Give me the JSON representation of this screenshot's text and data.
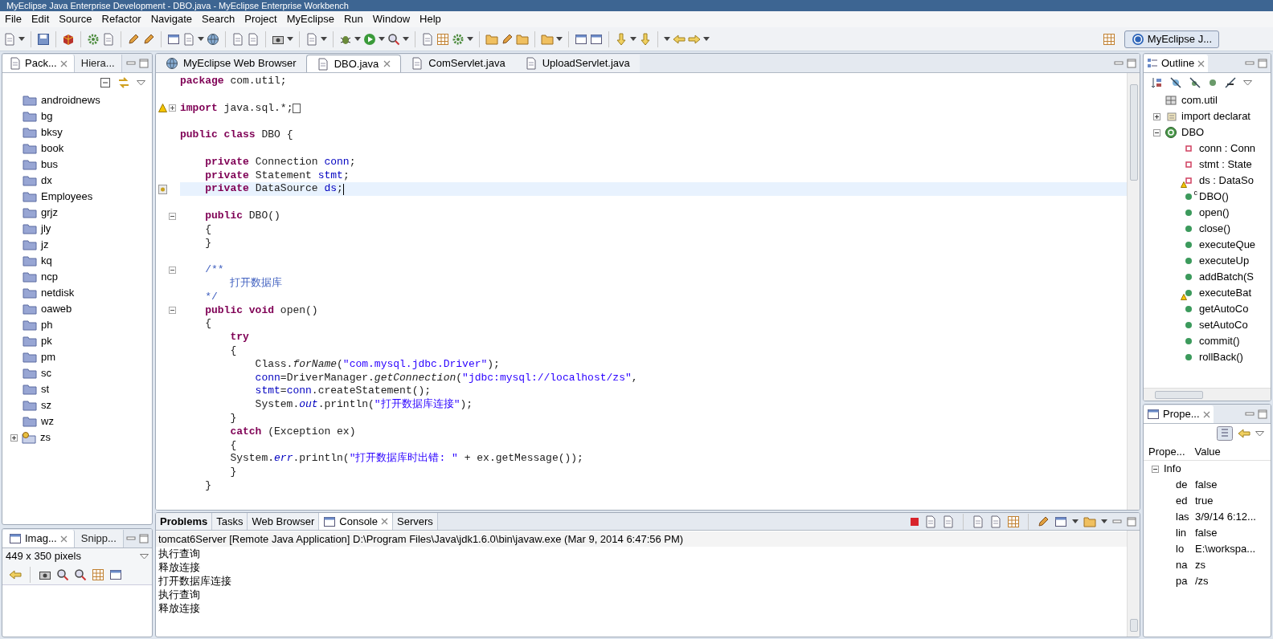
{
  "window": {
    "title": "MyEclipse Java Enterprise Development - DBO.java - MyEclipse Enterprise Workbench"
  },
  "menu": [
    "File",
    "Edit",
    "Source",
    "Refactor",
    "Navigate",
    "Search",
    "Project",
    "MyEclipse",
    "Run",
    "Window",
    "Help"
  ],
  "perspective": {
    "label": "MyEclipse J..."
  },
  "package_explorer": {
    "tabs": [
      {
        "label": "Pack...",
        "selected": true
      },
      {
        "label": "Hiera...",
        "selected": false
      }
    ],
    "items": [
      {
        "kind": "package",
        "label": "androidnews"
      },
      {
        "kind": "package",
        "label": "bg"
      },
      {
        "kind": "package",
        "label": "bksy"
      },
      {
        "kind": "package",
        "label": "book"
      },
      {
        "kind": "package",
        "label": "bus"
      },
      {
        "kind": "package",
        "label": "dx"
      },
      {
        "kind": "package",
        "label": "Employees"
      },
      {
        "kind": "package",
        "label": "grjz"
      },
      {
        "kind": "package",
        "label": "jly"
      },
      {
        "kind": "package",
        "label": "jz"
      },
      {
        "kind": "package",
        "label": "kq"
      },
      {
        "kind": "package",
        "label": "ncp"
      },
      {
        "kind": "package",
        "label": "netdisk"
      },
      {
        "kind": "package",
        "label": "oaweb"
      },
      {
        "kind": "package",
        "label": "ph"
      },
      {
        "kind": "package",
        "label": "pk"
      },
      {
        "kind": "package",
        "label": "pm"
      },
      {
        "kind": "package",
        "label": "sc"
      },
      {
        "kind": "package",
        "label": "st"
      },
      {
        "kind": "package",
        "label": "sz"
      },
      {
        "kind": "package",
        "label": "wz"
      },
      {
        "kind": "project",
        "label": "zs",
        "expanded": false
      }
    ]
  },
  "image_view": {
    "tabs": [
      {
        "label": "Imag...",
        "selected": true
      },
      {
        "label": "Snipp...",
        "selected": false
      }
    ],
    "size": "449 x 350 pixels"
  },
  "editor": {
    "tabs": [
      {
        "kind": "browser",
        "label": "MyEclipse Web Browser",
        "selected": false
      },
      {
        "kind": "java",
        "label": "DBO.java",
        "selected": true
      },
      {
        "kind": "java",
        "label": "ComServlet.java",
        "selected": false
      },
      {
        "kind": "java",
        "label": "UploadServlet.java",
        "selected": false
      }
    ],
    "lines": [
      {
        "kind": "code",
        "current": false,
        "segments": [
          {
            "text": "package",
            "kind": "keyword"
          },
          {
            "text": " com.util;",
            "kind": "plain"
          }
        ]
      },
      {
        "kind": "blank"
      },
      {
        "kind": "code",
        "current": false,
        "warning": true,
        "expanded": false,
        "segments": [
          {
            "text": "import",
            "kind": "keyword"
          },
          {
            "text": " java.sql.*;",
            "kind": "plain"
          }
        ]
      },
      {
        "kind": "blank"
      },
      {
        "kind": "code",
        "current": false,
        "segments": [
          {
            "text": "public class",
            "kind": "keyword"
          },
          {
            "text": " DBO {",
            "kind": "plain"
          }
        ]
      },
      {
        "kind": "blank"
      },
      {
        "kind": "code",
        "current": false,
        "segments": [
          {
            "text": "    private",
            "kind": "keyword"
          },
          {
            "text": " Connection ",
            "kind": "plain"
          },
          {
            "text": "conn",
            "kind": "field"
          },
          {
            "text": ";",
            "kind": "plain"
          }
        ]
      },
      {
        "kind": "code",
        "current": false,
        "segments": [
          {
            "text": "    private",
            "kind": "keyword"
          },
          {
            "text": " Statement ",
            "kind": "plain"
          },
          {
            "text": "stmt",
            "kind": "field"
          },
          {
            "text": ";",
            "kind": "plain"
          }
        ]
      },
      {
        "kind": "code",
        "current": true,
        "bookmark": true,
        "segments": [
          {
            "text": "    private",
            "kind": "keyword"
          },
          {
            "text": " DataSource ",
            "kind": "plain"
          },
          {
            "text": "ds",
            "kind": "field"
          },
          {
            "text": ";",
            "kind": "plain"
          }
        ]
      },
      {
        "kind": "blank"
      },
      {
        "kind": "code",
        "current": false,
        "expanded": true,
        "segments": [
          {
            "text": "    public",
            "kind": "keyword"
          },
          {
            "text": " DBO()",
            "kind": "plain"
          }
        ]
      },
      {
        "kind": "code",
        "current": false,
        "segments": [
          {
            "text": "    {",
            "kind": "plain"
          }
        ]
      },
      {
        "kind": "code",
        "current": false,
        "segments": [
          {
            "text": "    }",
            "kind": "plain"
          }
        ]
      },
      {
        "kind": "blank"
      },
      {
        "kind": "code",
        "current": false,
        "expanded": true,
        "segments": [
          {
            "text": "    /**",
            "kind": "comment"
          }
        ]
      },
      {
        "kind": "code",
        "current": false,
        "segments": [
          {
            "text": "        打开数据库",
            "kind": "comment"
          }
        ]
      },
      {
        "kind": "code",
        "current": false,
        "segments": [
          {
            "text": "    */",
            "kind": "comment"
          }
        ]
      },
      {
        "kind": "code",
        "current": false,
        "expanded": true,
        "segments": [
          {
            "text": "    public void",
            "kind": "keyword"
          },
          {
            "text": " open()",
            "kind": "plain"
          }
        ]
      },
      {
        "kind": "code",
        "current": false,
        "segments": [
          {
            "text": "    {",
            "kind": "plain"
          }
        ]
      },
      {
        "kind": "code",
        "current": false,
        "segments": [
          {
            "text": "        try",
            "kind": "keyword"
          }
        ]
      },
      {
        "kind": "code",
        "current": false,
        "segments": [
          {
            "text": "        {",
            "kind": "plain"
          }
        ]
      },
      {
        "kind": "code",
        "current": false,
        "segments": [
          {
            "text": "            Class.",
            "kind": "plain"
          },
          {
            "text": "forName",
            "kind": "static"
          },
          {
            "text": "(",
            "kind": "plain"
          },
          {
            "text": "\"com.mysql.jdbc.Driver\"",
            "kind": "string"
          },
          {
            "text": ");",
            "kind": "plain"
          }
        ]
      },
      {
        "kind": "code",
        "current": false,
        "segments": [
          {
            "text": "            conn",
            "kind": "field"
          },
          {
            "text": "=DriverManager.",
            "kind": "plain"
          },
          {
            "text": "getConnection",
            "kind": "static"
          },
          {
            "text": "(",
            "kind": "plain"
          },
          {
            "text": "\"jdbc:mysql://localhost/zs\"",
            "kind": "string"
          },
          {
            "text": ",",
            "kind": "plain"
          }
        ]
      },
      {
        "kind": "code",
        "current": false,
        "segments": [
          {
            "text": "            stmt",
            "kind": "field"
          },
          {
            "text": "=",
            "kind": "plain"
          },
          {
            "text": "conn",
            "kind": "field"
          },
          {
            "text": ".createStatement();",
            "kind": "plain"
          }
        ]
      },
      {
        "kind": "code",
        "current": false,
        "segments": [
          {
            "text": "            System.",
            "kind": "plain"
          },
          {
            "text": "out",
            "kind": "static_field"
          },
          {
            "text": ".println(",
            "kind": "plain"
          },
          {
            "text": "\"打开数据库连接\"",
            "kind": "string"
          },
          {
            "text": ");",
            "kind": "plain"
          }
        ]
      },
      {
        "kind": "code",
        "current": false,
        "segments": [
          {
            "text": "        }",
            "kind": "plain"
          }
        ]
      },
      {
        "kind": "code",
        "current": false,
        "segments": [
          {
            "text": "        catch",
            "kind": "keyword"
          },
          {
            "text": " (Exception ex)",
            "kind": "plain"
          }
        ]
      },
      {
        "kind": "code",
        "current": false,
        "segments": [
          {
            "text": "        {",
            "kind": "plain"
          }
        ]
      },
      {
        "kind": "code",
        "current": false,
        "segments": [
          {
            "text": "        System.",
            "kind": "plain"
          },
          {
            "text": "err",
            "kind": "static_field"
          },
          {
            "text": ".println(",
            "kind": "plain"
          },
          {
            "text": "\"打开数据库时出错: \"",
            "kind": "string"
          },
          {
            "text": " + ex.getMessage());",
            "kind": "plain"
          }
        ]
      },
      {
        "kind": "code",
        "current": false,
        "segments": [
          {
            "text": "        }",
            "kind": "plain"
          }
        ]
      },
      {
        "kind": "code",
        "current": false,
        "segments": [
          {
            "text": "    }",
            "kind": "plain"
          }
        ]
      }
    ]
  },
  "outline": {
    "title": "Outline",
    "items": [
      {
        "kind": "package",
        "label": "com.util"
      },
      {
        "kind": "imports",
        "label": "import declarat",
        "expanded": false
      },
      {
        "kind": "class",
        "label": "DBO",
        "expanded": true,
        "children": [
          {
            "kind": "field",
            "label": "conn : Conn",
            "warning": false
          },
          {
            "kind": "field",
            "label": "stmt : State",
            "warning": false
          },
          {
            "kind": "field",
            "label": "ds : DataSo",
            "warning": true
          },
          {
            "kind": "method",
            "label": "DBO()",
            "warning": false,
            "badge": "c"
          },
          {
            "kind": "method",
            "label": "open()",
            "warning": false
          },
          {
            "kind": "method",
            "label": "close()",
            "warning": false
          },
          {
            "kind": "method",
            "label": "executeQue",
            "warning": false
          },
          {
            "kind": "method",
            "label": "executeUp",
            "warning": false
          },
          {
            "kind": "method",
            "label": "addBatch(S",
            "warning": false
          },
          {
            "kind": "method",
            "label": "executeBat",
            "warning": true
          },
          {
            "kind": "method",
            "label": "getAutoCo",
            "warning": false
          },
          {
            "kind": "method",
            "label": "setAutoCo",
            "warning": false
          },
          {
            "kind": "method",
            "label": "commit()",
            "warning": false
          },
          {
            "kind": "method",
            "label": "rollBack()",
            "warning": false
          }
        ]
      }
    ]
  },
  "properties": {
    "title": "Prope...",
    "columns": [
      "Prope...",
      "Value"
    ],
    "groups": [
      {
        "label": "Info",
        "expanded": true,
        "rows": [
          {
            "key": "de",
            "value": "false"
          },
          {
            "key": "ed",
            "value": "true"
          },
          {
            "key": "las",
            "value": "3/9/14 6:12..."
          },
          {
            "key": "lin",
            "value": "false"
          },
          {
            "key": "lo",
            "value": "E:\\workspa..."
          },
          {
            "key": "na",
            "value": "zs"
          },
          {
            "key": "pa",
            "value": "/zs"
          }
        ]
      }
    ]
  },
  "bottom": {
    "tabs": [
      {
        "label": "Problems",
        "selected": false
      },
      {
        "label": "Tasks",
        "selected": false
      },
      {
        "label": "Web Browser",
        "selected": false
      },
      {
        "label": "Console",
        "selected": true
      },
      {
        "label": "Servers",
        "selected": false
      }
    ],
    "console": {
      "header": "tomcat6Server [Remote Java Application] D:\\Program Files\\Java\\jdk1.6.0\\bin\\javaw.exe (Mar 9, 2014 6:47:56 PM)",
      "lines": [
        "执行查询",
        "释放连接",
        "打开数据库连接",
        "执行查询",
        "释放连接"
      ]
    }
  }
}
